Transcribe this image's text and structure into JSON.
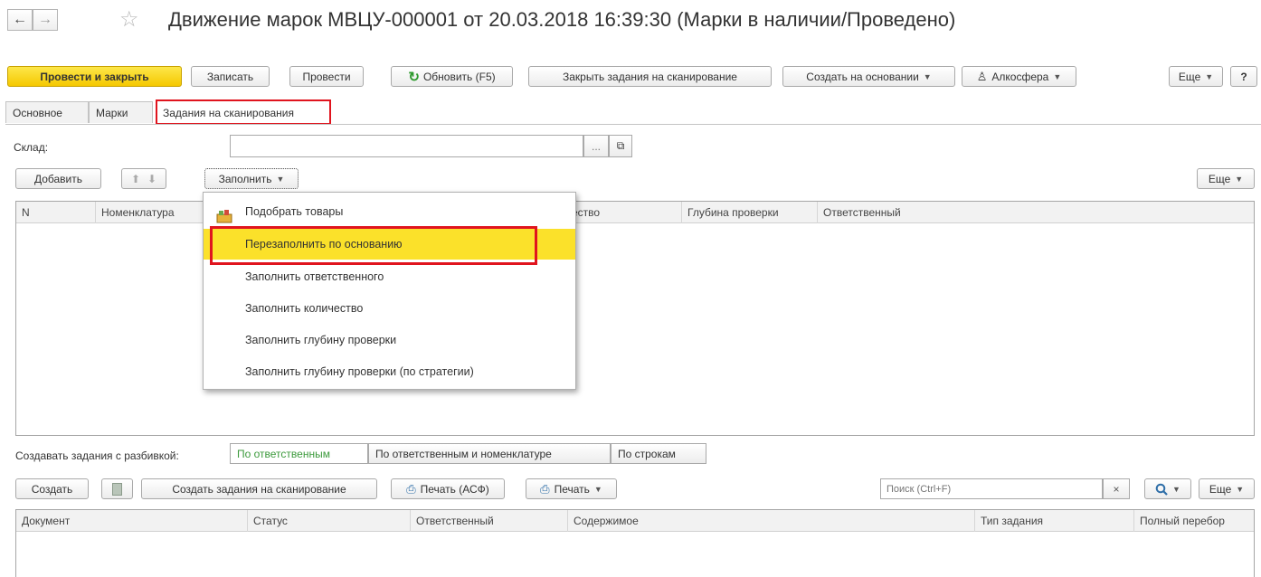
{
  "window": {
    "title": "Движение марок МВЦУ-000001 от 20.03.2018 16:39:30 (Марки в наличии/Проведено)",
    "back_glyph": "←",
    "forward_glyph": "→",
    "favorite_glyph": "☆"
  },
  "toolbar": {
    "post_close": "Провести и закрыть",
    "save": "Записать",
    "post": "Провести",
    "refresh": "Обновить (F5)",
    "close_tasks": "Закрыть задания на сканирование",
    "create_based": "Создать на основании",
    "alcosphere": "Алкосфера",
    "more": "Еще",
    "help": "?"
  },
  "tabs": [
    {
      "label": "Основное"
    },
    {
      "label": "Марки"
    },
    {
      "label": "Задания на сканирования"
    }
  ],
  "warehouse": {
    "label": "Склад:",
    "value": "",
    "select_glyph": "...",
    "open_glyph": "⧉"
  },
  "grid_toolbar": {
    "add": "Добавить",
    "up_glyph": "⬆",
    "down_glyph": "⬇",
    "fill": "Заполнить",
    "more": "Еще"
  },
  "upper_table": {
    "columns": [
      "N",
      "Номенклатура",
      "ество",
      "Глубина проверки",
      "Ответственный"
    ]
  },
  "fill_menu": {
    "items": [
      "Подобрать товары",
      "Перезаполнить по основанию",
      "Заполнить ответственного",
      "Заполнить количество",
      "Заполнить глубину проверки",
      "Заполнить глубину проверки (по стратегии)"
    ],
    "highlighted_index": 1
  },
  "split": {
    "label": "Создавать задания с разбивкой:",
    "options": [
      "По ответственным",
      "По ответственным и номенклатуре",
      "По строкам"
    ],
    "selected": "По ответственным"
  },
  "lower_toolbar": {
    "create": "Создать",
    "create_tasks": "Создать задания на сканирование",
    "print_asf": "Печать (АСФ)",
    "print": "Печать",
    "search_placeholder": "Поиск (Ctrl+F)",
    "clear_glyph": "×",
    "search_glyph": "🔍",
    "more": "Еще"
  },
  "lower_table": {
    "columns": [
      "Документ",
      "Статус",
      "Ответственный",
      "Содержимое",
      "Тип задания",
      "Полный перебор"
    ]
  },
  "colors": {
    "primary": "#f5c800",
    "highlight": "#fbe12a",
    "focus_red": "#e0141e",
    "active_green": "#3c9a3c"
  }
}
